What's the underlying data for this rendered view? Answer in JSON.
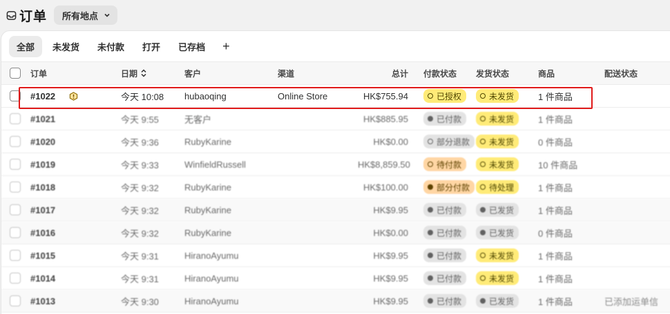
{
  "page": {
    "title": "订单",
    "location_button": "所有地点"
  },
  "tabs": [
    "全部",
    "未发货",
    "未付款",
    "打开",
    "已存档"
  ],
  "tab_add": "+",
  "columns": {
    "order": "订单",
    "date": "日期",
    "customer": "客户",
    "channel": "渠道",
    "total": "总计",
    "payment": "付款状态",
    "fulfillment": "发货状态",
    "items": "商品",
    "delivery": "配送状态"
  },
  "rows": [
    {
      "order": "#1022",
      "date": "今天 10:08",
      "customer": "hubaoqing",
      "channel": "Online Store",
      "total": "HK$755.94",
      "payment": "已授权",
      "fulfillment": "未发货",
      "items": "1 件商品",
      "delivery": ""
    },
    {
      "order": "#1021",
      "date": "今天 9:55",
      "customer": "无客户",
      "channel": "",
      "total": "HK$885.95",
      "payment": "已付款",
      "fulfillment": "未发货",
      "items": "1 件商品",
      "delivery": ""
    },
    {
      "order": "#1020",
      "date": "今天 9:36",
      "customer": "RubyKarine",
      "channel": "",
      "total": "HK$0.00",
      "payment": "部分退款",
      "fulfillment": "未发货",
      "items": "0 件商品",
      "delivery": ""
    },
    {
      "order": "#1019",
      "date": "今天 9:33",
      "customer": "WinfieldRussell",
      "channel": "",
      "total": "HK$8,859.50",
      "payment": "待付款",
      "fulfillment": "未发货",
      "items": "10 件商品",
      "delivery": ""
    },
    {
      "order": "#1018",
      "date": "今天 9:32",
      "customer": "RubyKarine",
      "channel": "",
      "total": "HK$100.00",
      "payment": "部分付款",
      "fulfillment": "待处理",
      "items": "1 件商品",
      "delivery": ""
    },
    {
      "order": "#1017",
      "date": "今天 9:32",
      "customer": "RubyKarine",
      "channel": "",
      "total": "HK$9.95",
      "payment": "已付款",
      "fulfillment": "已发货",
      "items": "1 件商品",
      "delivery": ""
    },
    {
      "order": "#1016",
      "date": "今天 9:32",
      "customer": "RubyKarine",
      "channel": "",
      "total": "HK$0.00",
      "payment": "已付款",
      "fulfillment": "已发货",
      "items": "0 件商品",
      "delivery": ""
    },
    {
      "order": "#1015",
      "date": "今天 9:31",
      "customer": "HiranoAyumu",
      "channel": "",
      "total": "HK$9.95",
      "payment": "已付款",
      "fulfillment": "未发货",
      "items": "1 件商品",
      "delivery": ""
    },
    {
      "order": "#1014",
      "date": "今天 9:31",
      "customer": "HiranoAyumu",
      "channel": "",
      "total": "HK$9.95",
      "payment": "已付款",
      "fulfillment": "未发货",
      "items": "1 件商品",
      "delivery": ""
    },
    {
      "order": "#1013",
      "date": "今天 9:30",
      "customer": "HiranoAyumu",
      "channel": "",
      "total": "HK$9.95",
      "payment": "已付款",
      "fulfillment": "已发货",
      "items": "1 件商品",
      "delivery": "已添加运单信"
    }
  ],
  "badge_styles": {
    "row0_payment": "yellow",
    "row0_fulfillment": "yellow",
    "row1_payment": "gray",
    "row1_fulfillment": "yellow",
    "row2_payment": "gray-ring",
    "row2_fulfillment": "yellow",
    "row3_payment": "orange",
    "row3_fulfillment": "yellow",
    "row4_payment": "orange-solid",
    "row4_fulfillment": "yellow",
    "row5_payment": "gray",
    "row5_fulfillment": "gray",
    "row6_payment": "gray",
    "row6_fulfillment": "gray",
    "row7_payment": "gray",
    "row7_fulfillment": "yellow",
    "row8_payment": "gray",
    "row8_fulfillment": "yellow",
    "row9_payment": "gray",
    "row9_fulfillment": "gray"
  },
  "colors": {
    "highlight_border": "#e01a1a",
    "badge_yellow": "#ffeb78",
    "badge_gray": "#e3e3e3",
    "badge_orange": "#ffd6a4"
  },
  "icons": {
    "title": "inbox-icon",
    "location": "chevron-down-icon",
    "sort": "sort-icon",
    "warning": "alert-circle-icon"
  }
}
